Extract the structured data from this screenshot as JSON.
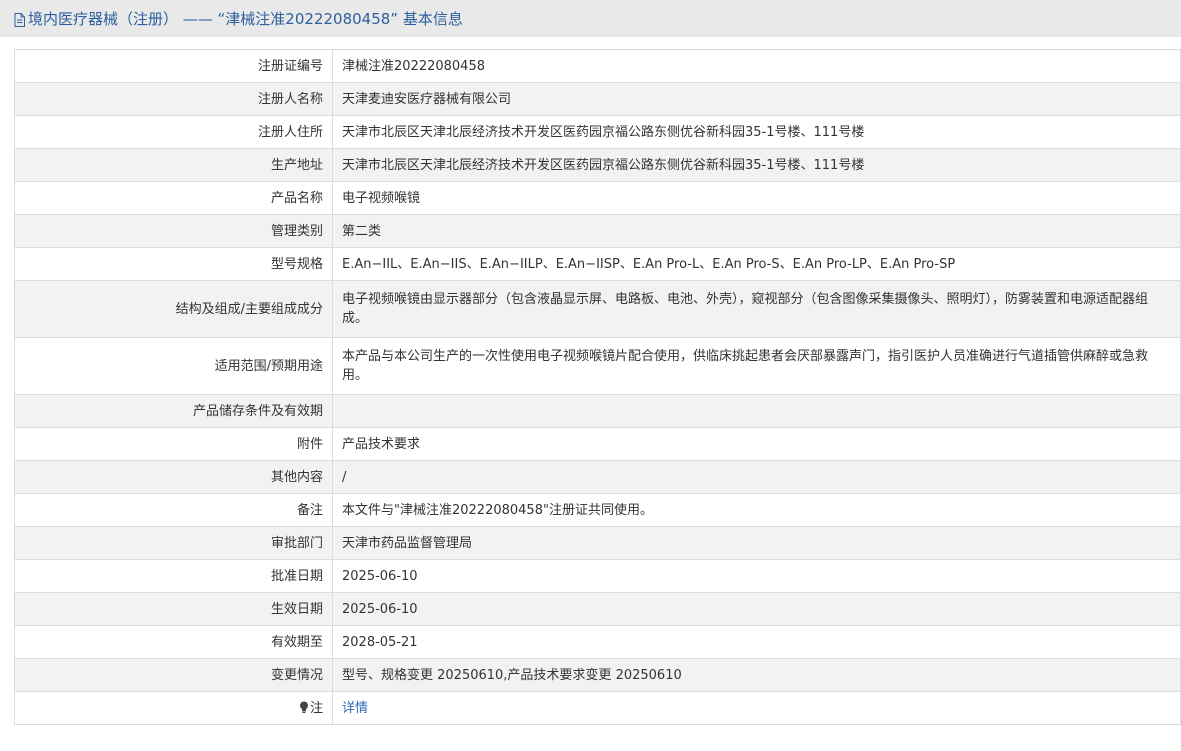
{
  "header": {
    "icon": "document-icon",
    "title": "境内医疗器械（注册） —— “津械注准20222080458” 基本信息"
  },
  "rows": [
    {
      "label": "注册证编号",
      "value": "津械注准20222080458"
    },
    {
      "label": "注册人名称",
      "value": "天津麦迪安医疗器械有限公司"
    },
    {
      "label": "注册人住所",
      "value": "天津市北辰区天津北辰经济技术开发区医药园京福公路东侧优谷新科园35-1号楼、111号楼"
    },
    {
      "label": "生产地址",
      "value": "天津市北辰区天津北辰经济技术开发区医药园京福公路东侧优谷新科园35-1号楼、111号楼"
    },
    {
      "label": "产品名称",
      "value": "电子视频喉镜"
    },
    {
      "label": "管理类别",
      "value": "第二类"
    },
    {
      "label": "型号规格",
      "value": "E.An−IIL、E.An−IIS、E.An−IILP、E.An−IISP、E.An Pro-L、E.An Pro-S、E.An Pro-LP、E.An Pro-SP"
    },
    {
      "label": "结构及组成/主要组成成分",
      "value": "电子视频喉镜由显示器部分（包含液晶显示屏、电路板、电池、外壳），窥视部分（包含图像采集摄像头、照明灯），防雾装置和电源适配器组成。"
    },
    {
      "label": "适用范围/预期用途",
      "value": "本产品与本公司生产的一次性使用电子视频喉镜片配合使用，供临床挑起患者会厌部暴露声门，指引医护人员准确进行气道插管供麻醉或急救用。"
    },
    {
      "label": "产品储存条件及有效期",
      "value": ""
    },
    {
      "label": "附件",
      "value": "产品技术要求"
    },
    {
      "label": "其他内容",
      "value": "/"
    },
    {
      "label": "备注",
      "value": "本文件与\"津械注准20222080458\"注册证共同使用。"
    },
    {
      "label": "审批部门",
      "value": "天津市药品监督管理局"
    },
    {
      "label": "批准日期",
      "value": "2025-06-10"
    },
    {
      "label": "生效日期",
      "value": "2025-06-10"
    },
    {
      "label": "有效期至",
      "value": "2028-05-21"
    },
    {
      "label": "变更情况",
      "value": "型号、规格变更 20250610,产品技术要求变更 20250610"
    }
  ],
  "note_row": {
    "icon": "lightbulb-icon",
    "label": "注",
    "link_text": "详情"
  },
  "colors": {
    "title_text": "#2b5f9e",
    "link": "#2b6ab8",
    "header_bg": "#e9e9e9",
    "row_alt_bg": "#f2f2f2",
    "border": "#dcdcdc"
  }
}
